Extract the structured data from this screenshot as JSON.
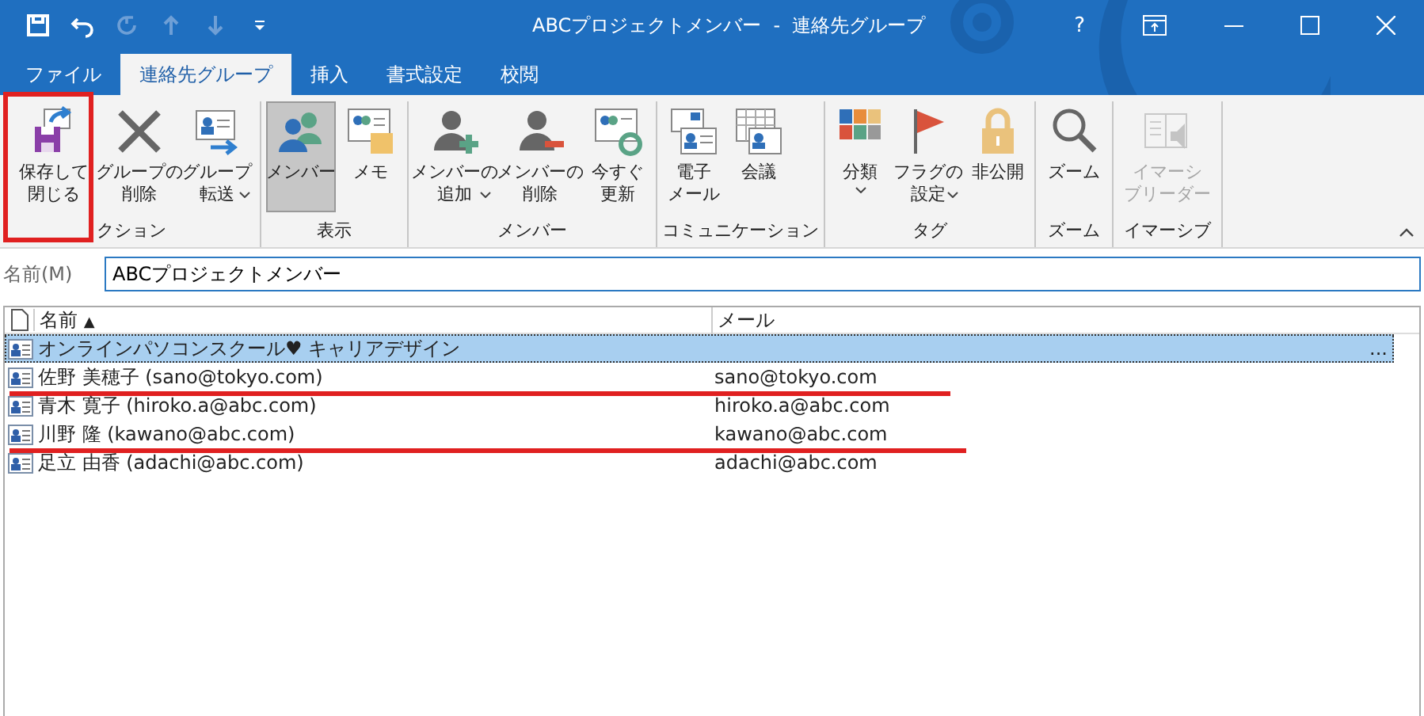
{
  "window": {
    "title": "ABCプロジェクトメンバー  -  連絡先グループ",
    "controls": [
      "?"
    ]
  },
  "quick_access": [
    {
      "disabled": false
    },
    {
      "disabled": false
    },
    {
      "disabled": true
    },
    {
      "disabled": true
    },
    {
      "disabled": true
    },
    {
      "disabled": false
    }
  ],
  "tabs": [
    {
      "label": "ファイル",
      "selected": false
    },
    {
      "label": "連絡先グループ",
      "selected": true
    },
    {
      "label": "挿入",
      "selected": false
    },
    {
      "label": "書式設定",
      "selected": false
    },
    {
      "label": "校閲",
      "selected": false
    }
  ],
  "ribbon": [
    {
      "label": "クション",
      "buttons": [
        {
          "lines": [
            "保存して",
            "閉じる"
          ],
          "dropdown": false,
          "selected": false,
          "disabled": false
        },
        {
          "lines": [
            "グループの",
            "削除"
          ],
          "dropdown": false,
          "selected": false,
          "disabled": false
        },
        {
          "lines": [
            "グループ",
            "転送"
          ],
          "dropdown": true,
          "selected": false,
          "disabled": false
        }
      ]
    },
    {
      "label": "表示",
      "buttons": [
        {
          "lines": [
            "メンバー"
          ],
          "dropdown": false,
          "selected": true,
          "disabled": false
        },
        {
          "lines": [
            "メモ"
          ],
          "dropdown": false,
          "selected": false,
          "disabled": false
        }
      ]
    },
    {
      "label": "メンバー",
      "buttons": [
        {
          "lines": [
            "メンバーの",
            "追加"
          ],
          "dropdown": true,
          "selected": false,
          "disabled": false
        },
        {
          "lines": [
            "メンバーの",
            "削除"
          ],
          "dropdown": false,
          "selected": false,
          "disabled": false
        },
        {
          "lines": [
            "今すぐ",
            "更新"
          ],
          "dropdown": false,
          "selected": false,
          "disabled": false
        }
      ]
    },
    {
      "label": "コミュニケーション",
      "buttons": [
        {
          "lines": [
            "電子",
            "メール"
          ],
          "dropdown": false,
          "selected": false,
          "disabled": false
        },
        {
          "lines": [
            "会議"
          ],
          "dropdown": false,
          "selected": false,
          "disabled": false
        }
      ]
    },
    {
      "label": "タグ",
      "buttons": [
        {
          "lines": [
            "分類"
          ],
          "dropdown": true,
          "selected": false,
          "disabled": false
        },
        {
          "lines": [
            "フラグの",
            "設定"
          ],
          "dropdown": true,
          "selected": false,
          "disabled": false
        },
        {
          "lines": [
            "非公開"
          ],
          "dropdown": false,
          "selected": false,
          "disabled": false
        }
      ]
    },
    {
      "label": "ズーム",
      "buttons": [
        {
          "lines": [
            "ズーム"
          ],
          "dropdown": false,
          "selected": false,
          "disabled": false
        }
      ]
    },
    {
      "label": "イマーシブ",
      "buttons": [
        {
          "lines": [
            "イマーシ",
            "ブリーダー"
          ],
          "dropdown": false,
          "selected": false,
          "disabled": true
        }
      ]
    }
  ],
  "name_field": {
    "label": "名前(M)",
    "value": "ABCプロジェクトメンバー"
  },
  "table": {
    "columns": [
      {
        "label": "名前",
        "sort_indicator": "▲"
      },
      {
        "label": "メール"
      }
    ],
    "rows": [
      {
        "name": "オンラインパソコンスクール♥ キャリアデザイン",
        "overflow": "...",
        "selected": true,
        "underlined": false
      },
      {
        "name": "佐野 美穂子 (sano@tokyo.com)",
        "mail": "sano@tokyo.com",
        "selected": false,
        "underlined": true
      },
      {
        "name": "青木 寛子 (hiroko.a@abc.com)",
        "mail": "hiroko.a@abc.com",
        "selected": false,
        "underlined": false
      },
      {
        "name": "川野 隆 (kawano@abc.com)",
        "mail": "kawano@abc.com",
        "selected": false,
        "underlined": true
      },
      {
        "name": "足立 由香 (adachi@abc.com)",
        "mail": "adachi@abc.com",
        "selected": false,
        "underlined": false
      }
    ]
  },
  "annotation": {
    "highlight_save_button": true
  }
}
